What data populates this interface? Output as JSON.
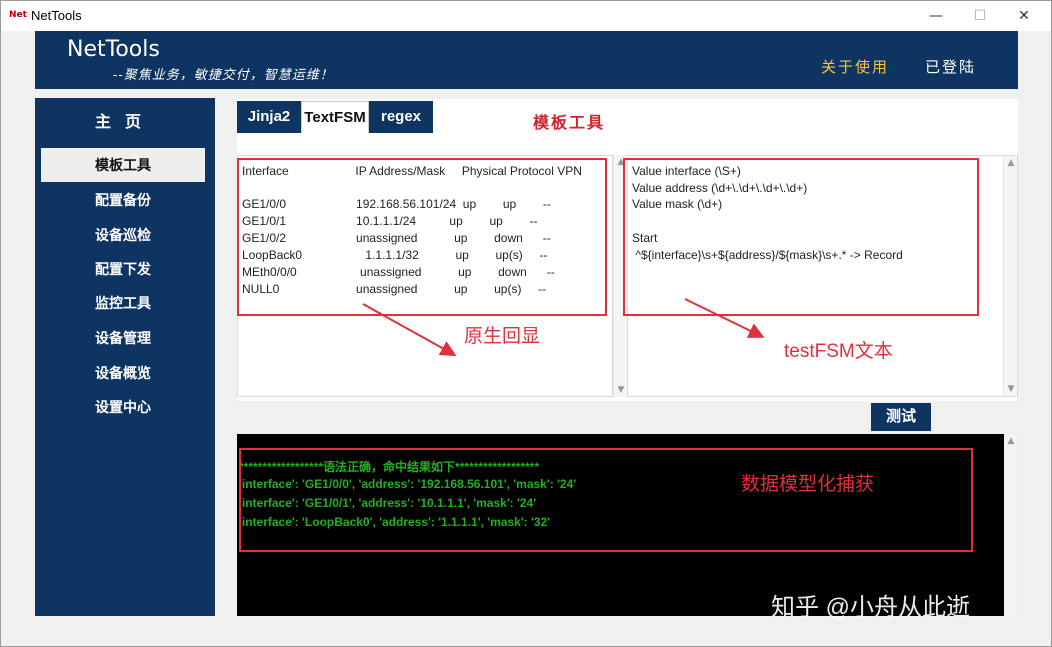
{
  "window": {
    "app_icon": "Net",
    "title": "NetTools",
    "minimize": "—",
    "maximize": "☐",
    "close": "✕"
  },
  "header": {
    "brand": "NetTools",
    "slogan": "--聚焦业务，敏捷交付，智慧运维！",
    "about": "关于使用",
    "login_status": "已登陆"
  },
  "sidebar": {
    "title": "主页",
    "items": [
      {
        "label": "模板工具"
      },
      {
        "label": "配置备份"
      },
      {
        "label": "设备巡检"
      },
      {
        "label": "配置下发"
      },
      {
        "label": "监控工具"
      },
      {
        "label": "设备管理"
      },
      {
        "label": "设备概览"
      },
      {
        "label": "设置中心"
      }
    ]
  },
  "tabs": [
    {
      "label": "Jinja2"
    },
    {
      "label": "TextFSM"
    },
    {
      "label": "regex"
    }
  ],
  "tab_heading": "模板工具",
  "raw_output": {
    "lines": [
      "Interface                    IP Address/Mask     Physical Protocol VPN",
      "",
      "GE1/0/0                     192.168.56.101/24  up        up        --",
      "GE1/0/1                     10.1.1.1/24          up        up        --",
      "GE1/0/2                     unassigned           up        down      --",
      "LoopBack0                   1.1.1.1/32           up        up(s)     --",
      "MEth0/0/0                   unassigned           up        down      --",
      "NULL0                       unassigned           up        up(s)     --"
    ]
  },
  "template_text": {
    "lines": [
      "Value interface (\\S+)",
      "Value address (\\d+\\.\\d+\\.\\d+\\.\\d+)",
      "Value mask (\\d+)",
      "",
      "Start",
      " ^${interface}\\s+${address}/${mask}\\s+.* -> Record"
    ]
  },
  "annotations": {
    "raw": "原生回显",
    "template": "testFSM文本",
    "result": "数据模型化捕获"
  },
  "test_button": "测试",
  "console": {
    "lines": [
      "******************语法正确，命中结果如下******************",
      "'interface': 'GE1/0/0', 'address': '192.168.56.101', 'mask': '24'",
      "'interface': 'GE1/0/1', 'address': '10.1.1.1', 'mask': '24'",
      "'interface': 'LoopBack0', 'address': '1.1.1.1', 'mask': '32'"
    ]
  },
  "watermark": "知乎 @小舟从此逝",
  "colors": {
    "navy": "#0e3461",
    "annotation_red": "#e0303a",
    "console_green": "#22b022",
    "about_gold": "#f4c542"
  }
}
